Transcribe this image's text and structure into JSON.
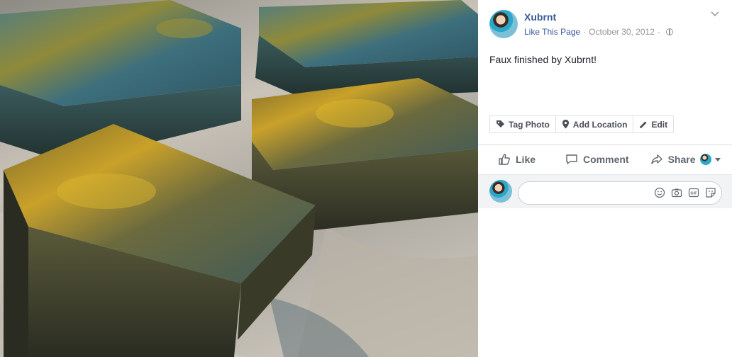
{
  "post": {
    "page_name": "Xubrnt",
    "like_page": "Like This Page",
    "separator": "·",
    "date": "October 30, 2012",
    "caption": "Faux finished by Xubrnt!"
  },
  "tag_bar": {
    "tag_photo": "Tag Photo",
    "add_location": "Add Location",
    "edit": "Edit"
  },
  "actions": {
    "like": "Like",
    "comment": "Comment",
    "share": "Share"
  },
  "comment_box": {
    "placeholder": ""
  },
  "icons": [
    "chevron-down-icon",
    "globe-icon",
    "tag-icon",
    "location-pin-icon",
    "pencil-icon",
    "thumbs-up-icon",
    "comment-bubble-icon",
    "share-arrow-icon",
    "emoji-icon",
    "camera-icon",
    "gif-icon",
    "sticker-icon"
  ],
  "colors": {
    "link_blue": "#365899",
    "meta_gray": "#90949c",
    "action_gray": "#606770",
    "border": "#dddfe2"
  }
}
